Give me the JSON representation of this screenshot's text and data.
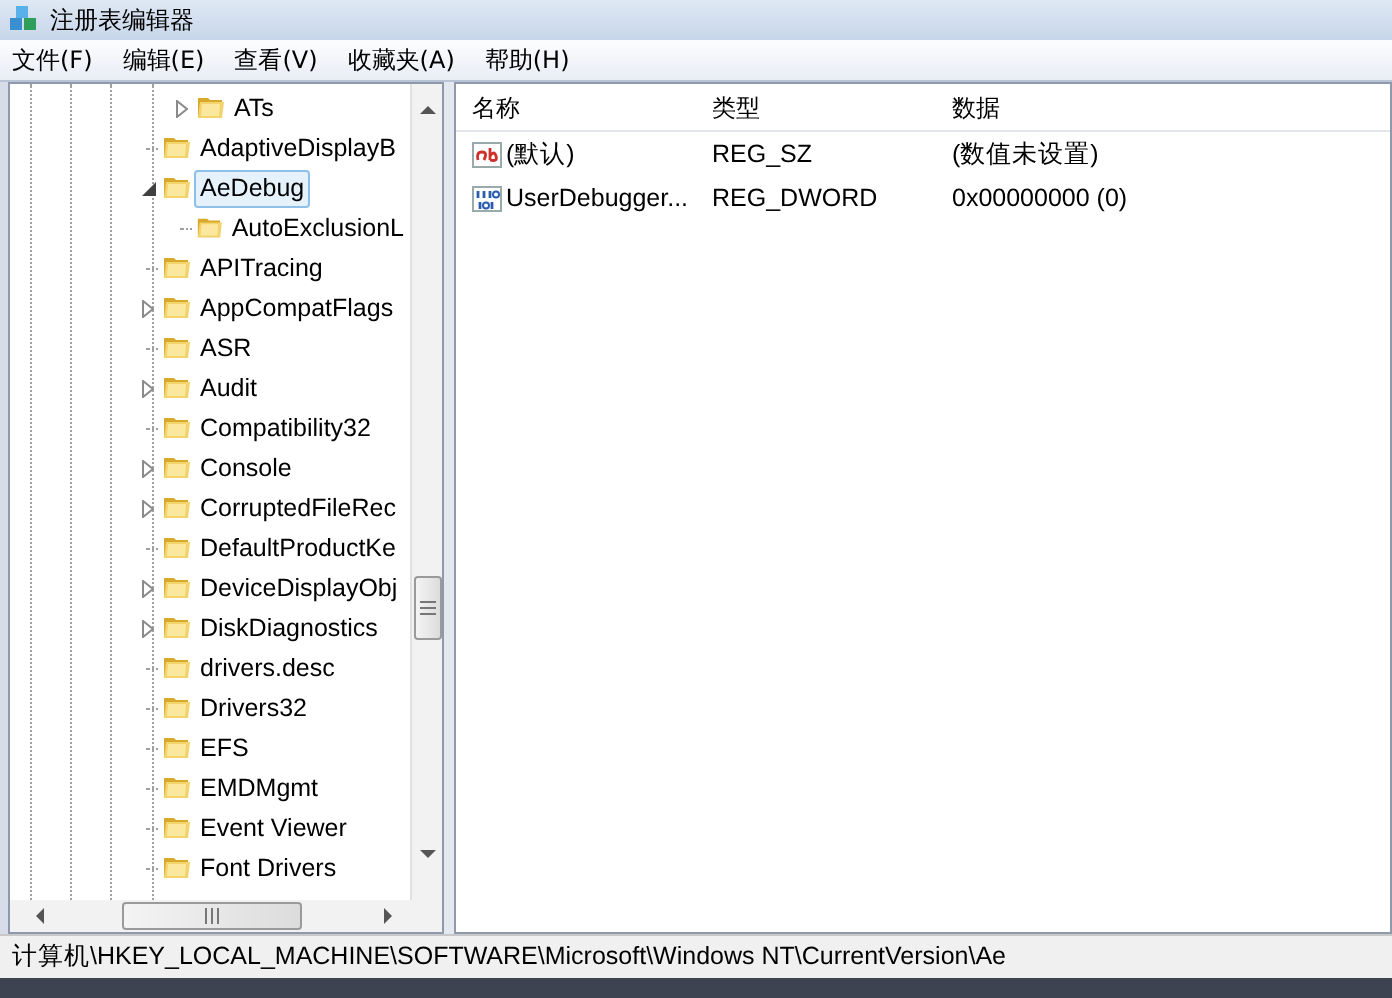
{
  "window": {
    "title": "注册表编辑器"
  },
  "menu": [
    {
      "label": "文件(F)"
    },
    {
      "label": "编辑(E)"
    },
    {
      "label": "查看(V)"
    },
    {
      "label": "收藏夹(A)"
    },
    {
      "label": "帮助(H)"
    }
  ],
  "tree": {
    "tail_items": [
      {
        "label": "ATs",
        "expanded": false,
        "selected": false
      }
    ],
    "items": [
      {
        "label": "AdaptiveDisplayB",
        "selected": false
      },
      {
        "label": "AeDebug",
        "expanded": true,
        "selected": true,
        "children": [
          {
            "label": "AutoExclusionL",
            "selected": false
          }
        ]
      },
      {
        "label": "APITracing",
        "selected": false
      },
      {
        "label": "AppCompatFlags",
        "expanded": false,
        "selected": false
      },
      {
        "label": "ASR",
        "selected": false
      },
      {
        "label": "Audit",
        "expanded": false,
        "selected": false
      },
      {
        "label": "Compatibility32",
        "selected": false
      },
      {
        "label": "Console",
        "expanded": false,
        "selected": false
      },
      {
        "label": "CorruptedFileRec",
        "expanded": false,
        "selected": false
      },
      {
        "label": "DefaultProductKe",
        "selected": false
      },
      {
        "label": "DeviceDisplayObj",
        "expanded": false,
        "selected": false
      },
      {
        "label": "DiskDiagnostics",
        "expanded": false,
        "selected": false
      },
      {
        "label": "drivers.desc",
        "selected": false
      },
      {
        "label": "Drivers32",
        "selected": false
      },
      {
        "label": "EFS",
        "selected": false
      },
      {
        "label": "EMDMgmt",
        "selected": false
      },
      {
        "label": "Event Viewer",
        "selected": false
      },
      {
        "label": "Font Drivers",
        "selected": false
      }
    ]
  },
  "values": {
    "columns": [
      "名称",
      "类型",
      "数据"
    ],
    "rows": [
      {
        "kind": "string",
        "name": "(默认)",
        "type": "REG_SZ",
        "data": "(数值未设置)"
      },
      {
        "kind": "binary",
        "name": "UserDebugger...",
        "type": "REG_DWORD",
        "data": "0x00000000 (0)"
      }
    ]
  },
  "status_bar": "计算机\\HKEY_LOCAL_MACHINE\\SOFTWARE\\Microsoft\\Windows NT\\CurrentVersion\\Ae"
}
